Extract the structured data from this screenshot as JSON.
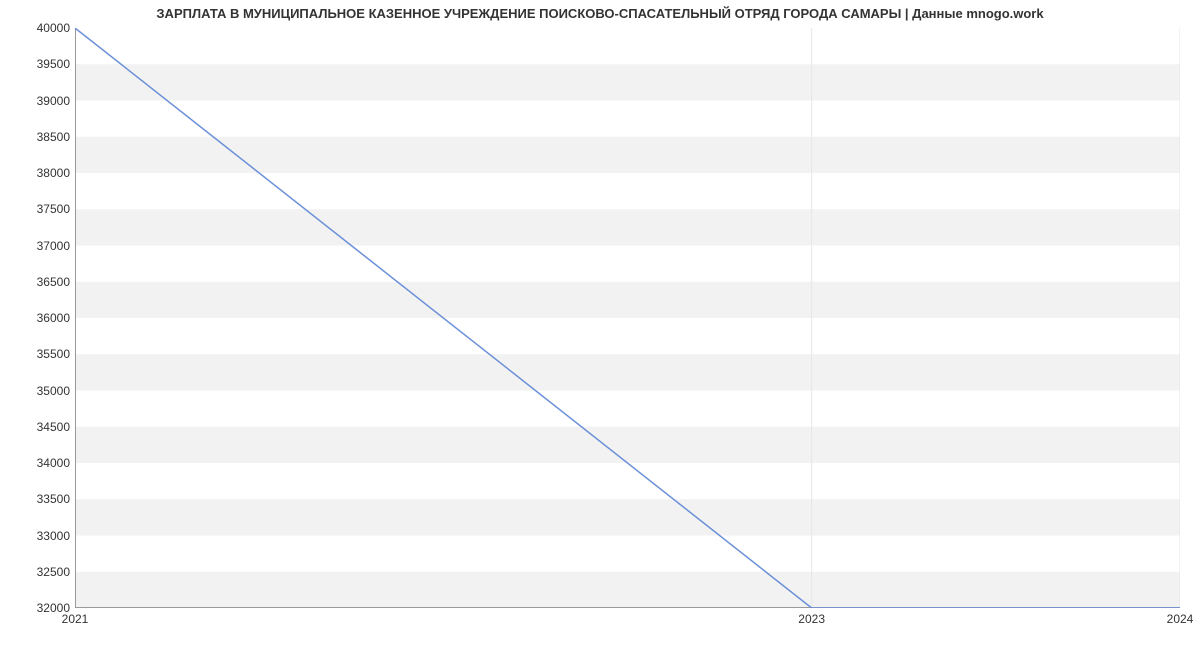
{
  "chart_data": {
    "type": "line",
    "title": "ЗАРПЛАТА В МУНИЦИПАЛЬНОЕ КАЗЕННОЕ УЧРЕЖДЕНИЕ ПОИСКОВО-СПАСАТЕЛЬНЫЙ ОТРЯД ГОРОДА САМАРЫ | Данные mnogo.work",
    "xlabel": "",
    "ylabel": "",
    "x": [
      2021,
      2023,
      2024
    ],
    "values": [
      40000,
      32000,
      32000
    ],
    "x_ticks": [
      2021,
      2023,
      2024
    ],
    "y_ticks": [
      32000,
      32500,
      33000,
      33500,
      34000,
      34500,
      35000,
      35500,
      36000,
      36500,
      37000,
      37500,
      38000,
      38500,
      39000,
      39500,
      40000
    ],
    "xlim": [
      2021,
      2024
    ],
    "ylim": [
      32000,
      40000
    ],
    "line_color": "#6a8fd8",
    "grid_band_color": "#f2f2f2"
  }
}
